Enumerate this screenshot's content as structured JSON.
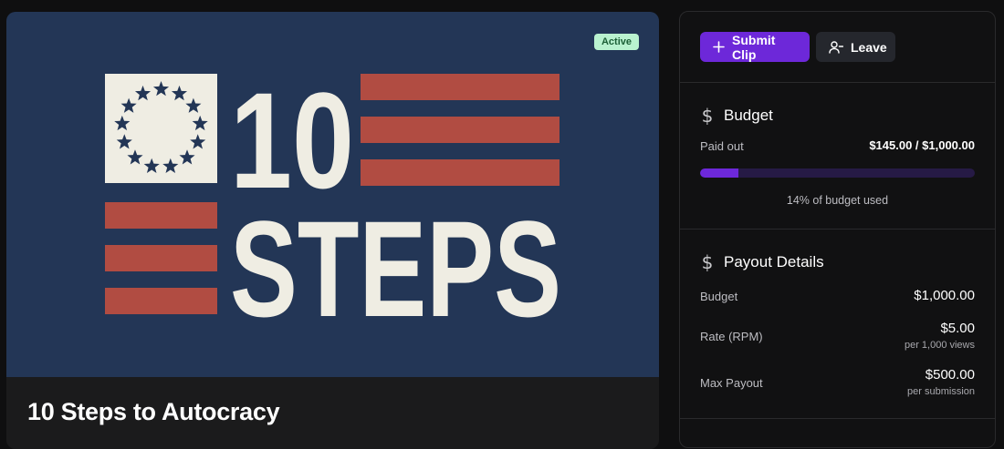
{
  "campaign": {
    "title": "10 Steps to Autocracy",
    "status_badge": "Active",
    "artwork_text": {
      "line1": "10",
      "line2": "STEPS"
    },
    "colors": {
      "artwork_background": "#233656",
      "stripe_red": "#b14c42",
      "cream": "#efede3",
      "star_navy": "#233656"
    }
  },
  "actions": {
    "submit_label": "Submit Clip",
    "submit_icon": "plus-icon",
    "leave_label": "Leave",
    "leave_icon": "user-minus-icon",
    "primary_color": "#6d28d9"
  },
  "budget": {
    "heading": "Budget",
    "heading_icon": "dollar-icon",
    "paid_out_label": "Paid out",
    "paid_out_value": "$145.00 / $1,000.00",
    "progress_fraction": 0.14,
    "progress_caption": "14% of budget used"
  },
  "payout": {
    "heading": "Payout Details",
    "heading_icon": "dollar-icon",
    "rows": [
      {
        "label": "Budget",
        "value": "$1,000.00",
        "sub": ""
      },
      {
        "label": "Rate (RPM)",
        "value": "$5.00",
        "sub": "per 1,000 views"
      },
      {
        "label": "Max Payout",
        "value": "$500.00",
        "sub": "per submission"
      }
    ]
  }
}
